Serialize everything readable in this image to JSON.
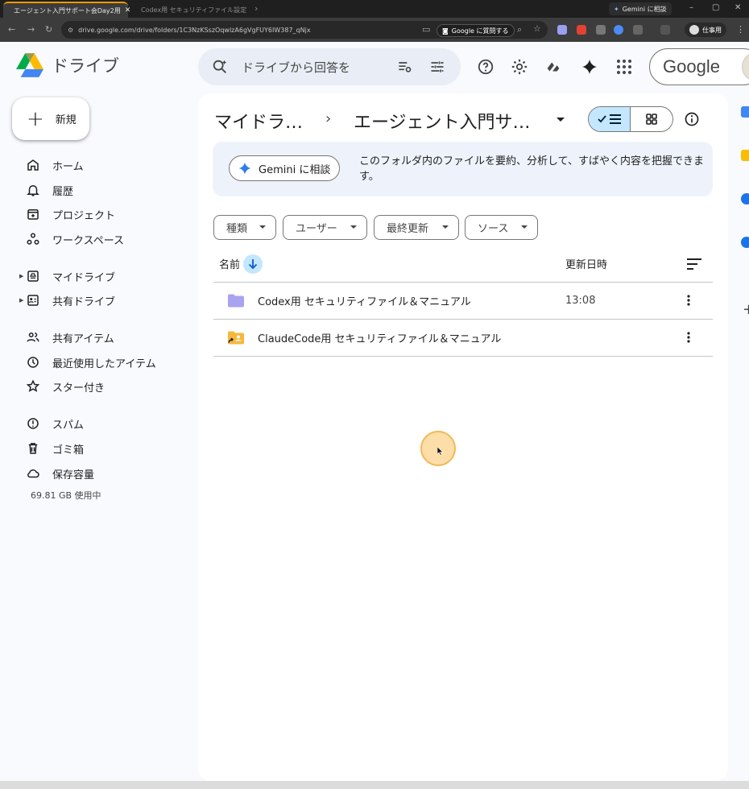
{
  "browser": {
    "tabs": [
      {
        "title": "エージェント入門サポート会Day2用",
        "active": true
      },
      {
        "title": "Codex用 セキュリティファイル設定",
        "active": false
      }
    ],
    "gemini_button": "Gemini に相談",
    "url": "drive.google.com/drive/folders/1C3NzKSszOqwlzA6gVgFUY6IW387_qNjx",
    "ask_google": "Google に質問する",
    "profile": "仕事用"
  },
  "header": {
    "app_name": "ドライブ",
    "search_placeholder": "ドライブから回答を",
    "account_logo_text": "Google"
  },
  "sidebar": {
    "new_button": "新規",
    "groups": [
      [
        {
          "label": "ホーム",
          "icon": "home-icon"
        },
        {
          "label": "履歴",
          "icon": "bell-icon"
        },
        {
          "label": "プロジェクト",
          "icon": "project-icon"
        },
        {
          "label": "ワークスペース",
          "icon": "workspace-icon"
        }
      ],
      [
        {
          "label": "マイドライブ",
          "icon": "my-drive-icon",
          "expandable": true
        },
        {
          "label": "共有ドライブ",
          "icon": "shared-drive-icon",
          "expandable": true
        }
      ],
      [
        {
          "label": "共有アイテム",
          "icon": "shared-people-icon"
        },
        {
          "label": "最近使用したアイテム",
          "icon": "clock-icon"
        },
        {
          "label": "スター付き",
          "icon": "star-icon"
        }
      ],
      [
        {
          "label": "スパム",
          "icon": "spam-icon"
        },
        {
          "label": "ゴミ箱",
          "icon": "trash-icon"
        },
        {
          "label": "保存容量",
          "icon": "cloud-icon"
        }
      ]
    ],
    "storage_used": "69.81 GB 使用中"
  },
  "main": {
    "breadcrumb": {
      "root": "マイドラ…",
      "current": "エージェント入門サ…"
    },
    "gemini_banner": {
      "button": "Gemini に相談",
      "text": "このフォルダ内のファイルを要約、分析して、すばやく内容を把握できます。"
    },
    "filters": [
      "種類",
      "ユーザー",
      "最終更新",
      "ソース"
    ],
    "columns": {
      "name": "名前",
      "modified": "更新日時"
    },
    "files": [
      {
        "name": "Codex用 セキュリティファイル＆マニュアル",
        "modified": "13:08",
        "type": "folder",
        "color": "#a8a4f0"
      },
      {
        "name": "ClaudeCode用 セキュリティファイル＆マニュアル",
        "modified": "",
        "type": "shared-folder-shortcut",
        "color": "#f6b73c"
      }
    ]
  },
  "colors": {
    "accent_selected": "#c2e7ff",
    "page_bg": "#f8fafd",
    "search_bg": "#e9eef6"
  }
}
